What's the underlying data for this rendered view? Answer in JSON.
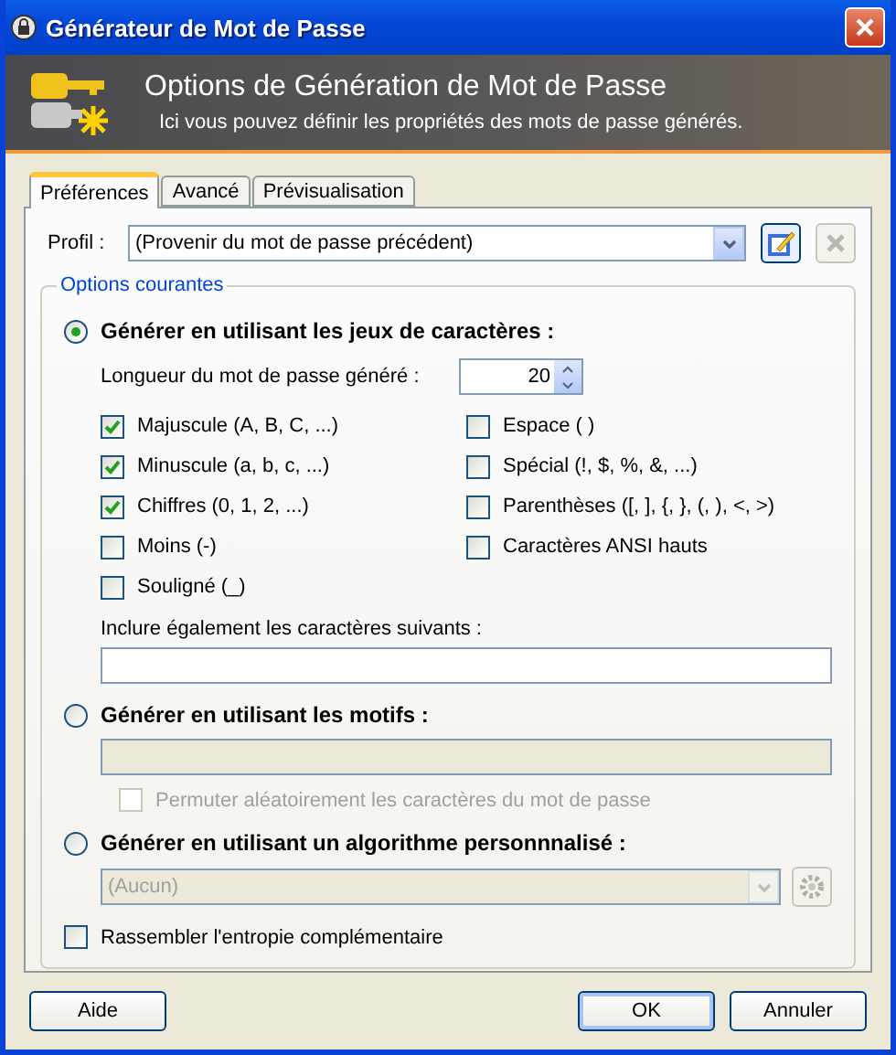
{
  "window": {
    "title": "Générateur de Mot de Passe"
  },
  "banner": {
    "title": "Options de Génération de Mot de Passe",
    "subtitle": "Ici vous pouvez définir les propriétés des mots de passe générés."
  },
  "tabs": [
    {
      "label": "Préférences",
      "selected": true
    },
    {
      "label": "Avancé",
      "selected": false
    },
    {
      "label": "Prévisualisation",
      "selected": false
    }
  ],
  "profile": {
    "label": "Profil :",
    "value": "(Provenir du mot de passe précédent)"
  },
  "group": {
    "title": "Options courantes"
  },
  "charset_mode": {
    "label": "Générer en utilisant les jeux de caractères :",
    "selected": true
  },
  "length": {
    "label": "Longueur du mot de passe généré :",
    "value": "20"
  },
  "charsets": [
    {
      "label": "Majuscule (A, B, C, ...)",
      "checked": true
    },
    {
      "label": "Minuscule (a, b, c, ...)",
      "checked": true
    },
    {
      "label": "Chiffres (0, 1, 2, ...)",
      "checked": true
    },
    {
      "label": "Moins (-)",
      "checked": false
    },
    {
      "label": "Souligné (_)",
      "checked": false
    },
    {
      "label": "Espace ( )",
      "checked": false
    },
    {
      "label": "Spécial (!, $, %, &, ...)",
      "checked": false
    },
    {
      "label": "Parenthèses ([, ], {, }, (, ), <, >)",
      "checked": false
    },
    {
      "label": "Caractères ANSI hauts",
      "checked": false
    }
  ],
  "include": {
    "label": "Inclure également les caractères suivants :"
  },
  "pattern_mode": {
    "label": "Générer en utilisant les motifs :",
    "selected": false
  },
  "pattern_field": {
    "disabled": true
  },
  "permute": {
    "label": "Permuter aléatoirement les caractères du mot de passe",
    "checked": false,
    "disabled": true
  },
  "custom_mode": {
    "label": "Générer en utilisant un algorithme personnnalisé :",
    "selected": false
  },
  "algorithm": {
    "value": "(Aucun)",
    "disabled": true
  },
  "entropy": {
    "label": "Rassembler l'entropie complémentaire",
    "checked": false
  },
  "buttons": [
    {
      "label": "Aide",
      "default": false
    },
    {
      "label": "OK",
      "default": true
    },
    {
      "label": "Annuler",
      "default": false
    }
  ]
}
